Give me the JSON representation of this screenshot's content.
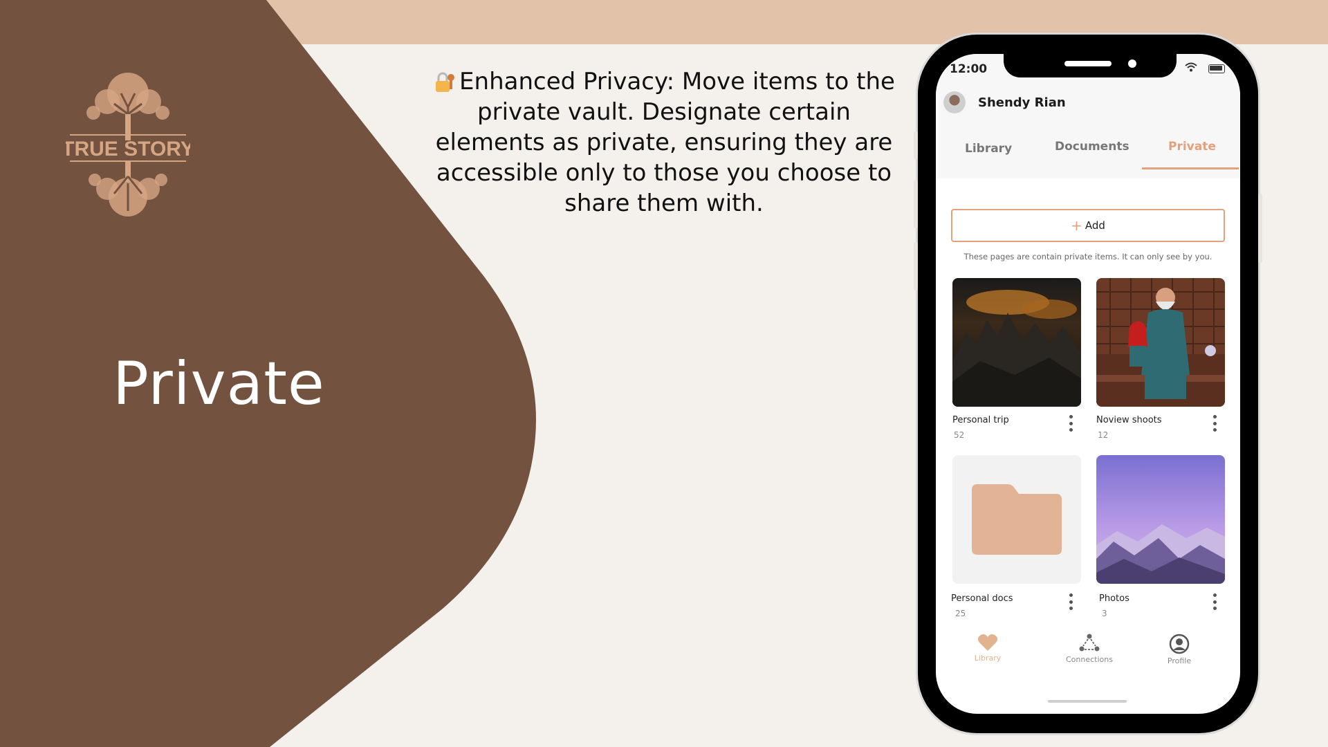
{
  "colors": {
    "background": "#f4f0ec",
    "top_band": "#e2c3aa",
    "brown_panel": "#735240",
    "accent": "#e2a17c",
    "logo": "#d6a583"
  },
  "logo": {
    "text": "TRUE STORY"
  },
  "hero": {
    "title": "Private"
  },
  "description": {
    "icon": "lock-with-key-emoji",
    "text": "Enhanced Privacy: Move items to the private vault. Designate certain elements as private, ensuring they are accessible only to those you choose to share them with."
  },
  "phone": {
    "status_bar": {
      "time": "12:00",
      "icons": [
        "wifi-icon",
        "battery-icon"
      ]
    },
    "user": {
      "name": "Shendy Rian"
    },
    "tabs": [
      {
        "label": "Library",
        "active": false
      },
      {
        "label": "Documents",
        "active": false
      },
      {
        "label": "Private",
        "active": true
      }
    ],
    "add_button": {
      "label": "Add"
    },
    "hint": "These pages are contain private items. It can only see by you.",
    "cards": [
      {
        "title": "Personal trip",
        "count": "52",
        "image": "mountain-sunset-photo"
      },
      {
        "title": "Noview shoots",
        "count": "12",
        "image": "grandfather-child-photo"
      },
      {
        "title": "Personal docs",
        "count": "25",
        "image": "folder-icon"
      },
      {
        "title": "Photos",
        "count": "3",
        "image": "purple-mountain-photo"
      }
    ],
    "bottom_nav": [
      {
        "label": "Library",
        "icon": "heart-icon",
        "active": true
      },
      {
        "label": "Connections",
        "icon": "connections-icon",
        "active": false
      },
      {
        "label": "Profile",
        "icon": "profile-icon",
        "active": false
      }
    ]
  }
}
